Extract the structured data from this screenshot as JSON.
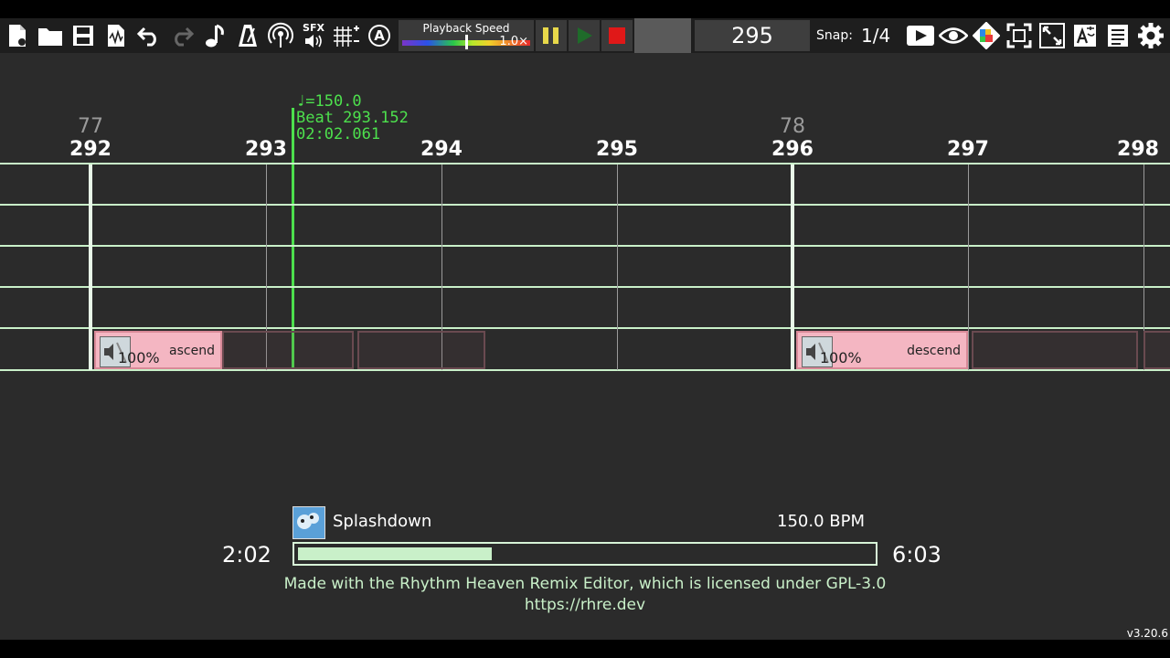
{
  "toolbar": {
    "icons": [
      "new-file-icon",
      "open-folder-icon",
      "save-icon",
      "export-audio-icon",
      "undo-icon",
      "redo-icon",
      "music-note-icon",
      "metronome-icon",
      "broadcast-icon",
      "sfx-icon",
      "grid-icon",
      "autosave-icon"
    ],
    "sfx_label": "SFX",
    "auto_label": "A",
    "playback_speed_label": "Playback Speed",
    "playback_speed_value": "1.0×",
    "playback_speed_fraction": 0.5,
    "beat_display": "295",
    "snap_label": "Snap:",
    "snap_value": "1/4",
    "right_icons": [
      "presentation-icon",
      "view-icon",
      "theme-icon",
      "fullscreen-icon",
      "resize-icon",
      "language-icon",
      "info-icon",
      "settings-icon"
    ]
  },
  "timeline": {
    "measure_labels": [
      {
        "measure": "77",
        "beat": 292
      },
      {
        "measure": "78",
        "beat": 296
      }
    ],
    "beat_labels": [
      "292",
      "293",
      "294",
      "295",
      "296",
      "297",
      "298"
    ],
    "playhead": {
      "tempo": "♩=150.0",
      "beat": "Beat 293.152",
      "time": "02:02.061",
      "position_beat": 293.152
    },
    "cues": [
      {
        "label": "ascend",
        "volume": "100%",
        "start_beat": 292.02,
        "end_beat": 292.75,
        "style": "pink"
      },
      {
        "label": "",
        "volume": "",
        "start_beat": 292.75,
        "end_beat": 293.5,
        "style": "ghost"
      },
      {
        "label": "",
        "volume": "",
        "start_beat": 293.52,
        "end_beat": 294.25,
        "style": "ghost"
      },
      {
        "label": "descend",
        "volume": "100%",
        "start_beat": 296.02,
        "end_beat": 297.0,
        "style": "pink"
      },
      {
        "label": "",
        "volume": "",
        "start_beat": 297.02,
        "end_beat": 297.97,
        "style": "ghost"
      },
      {
        "label": "",
        "volume": "",
        "start_beat": 298.0,
        "end_beat": 298.2,
        "style": "ghost"
      }
    ]
  },
  "footer": {
    "song_title": "Splashdown",
    "bpm": "150.0 BPM",
    "time_current": "2:02",
    "time_total": "6:03",
    "progress_fraction": 0.337,
    "credit_line1": "Made with the Rhythm Heaven Remix Editor, which is licensed under GPL-3.0",
    "credit_line2": "https://rhre.dev",
    "version": "v3.20.6"
  },
  "colors": {
    "background": "#2b2b2b",
    "accent_green": "#4de04d",
    "grid_line": "#c9f0c9",
    "cue_pink": "#f4b6c2"
  }
}
